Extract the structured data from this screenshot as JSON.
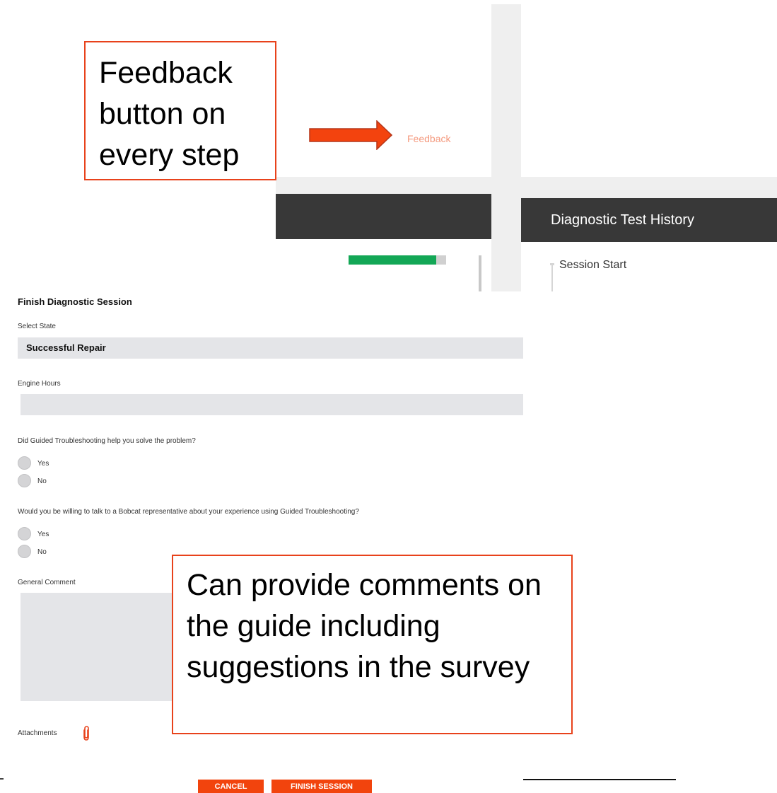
{
  "callouts": {
    "feedback_note": "Feedback button on every step",
    "comments_note": "Can provide comments on the guide including suggestions in the survey"
  },
  "header": {
    "feedback_link": "Feedback",
    "history_title": "Diagnostic Test History",
    "timeline_first": "Session Start",
    "progress_fraction": 0.9
  },
  "form": {
    "title": "Finish Diagnostic Session",
    "state_label": "Select State",
    "state_value": "Successful Repair",
    "engine_hours_label": "Engine Hours",
    "engine_hours_value": "",
    "q1": {
      "text": "Did Guided Troubleshooting help you solve the problem?",
      "options": [
        "Yes",
        "No"
      ]
    },
    "q2": {
      "text": "Would you be willing to talk to a Bobcat representative about your experience using Guided Troubleshooting?",
      "options": [
        "Yes",
        "No"
      ]
    },
    "comment_label": "General Comment",
    "attachments_label": "Attachments",
    "cancel_label": "CANCEL",
    "finish_label": "FINISH SESSION"
  },
  "colors": {
    "accent": "#f2440d",
    "callout_border": "#e8421b",
    "progress": "#13a756",
    "dark_header": "#383838"
  },
  "icons": {
    "attachment": "paperclip-icon",
    "callout_arrow": "arrow-right-icon"
  }
}
